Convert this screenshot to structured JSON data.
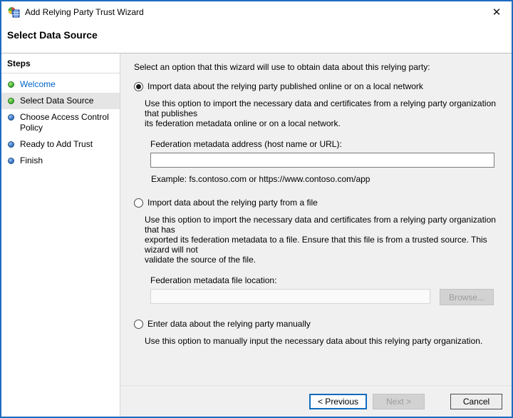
{
  "window": {
    "title": "Add Relying Party Trust Wizard",
    "close_glyph": "✕"
  },
  "page": {
    "heading": "Select Data Source"
  },
  "sidebar": {
    "title": "Steps",
    "items": [
      {
        "label": "Welcome",
        "state": "completed-link"
      },
      {
        "label": "Select Data Source",
        "state": "current"
      },
      {
        "label": "Choose Access Control Policy",
        "state": "pending"
      },
      {
        "label": "Ready to Add Trust",
        "state": "pending"
      },
      {
        "label": "Finish",
        "state": "pending"
      }
    ]
  },
  "content": {
    "intro": "Select an option that this wizard will use to obtain data about this relying party:",
    "options": [
      {
        "label": "Import data about the relying party published online or on a local network",
        "selected": true,
        "description": "Use this option to import the necessary data and certificates from a relying party organization that publishes\nits federation metadata online or on a local network.",
        "field_label": "Federation metadata address (host name or URL):",
        "field_value": "",
        "example": "Example: fs.contoso.com or https://www.contoso.com/app"
      },
      {
        "label": "Import data about the relying party from a file",
        "selected": false,
        "description": "Use this option to import the necessary data and certificates from a relying party organization that has\nexported its federation metadata to a file. Ensure that this file is from a trusted source.  This wizard will not\nvalidate the source of the file.",
        "field_label": "Federation metadata file location:",
        "field_value": "",
        "browse_label": "Browse..."
      },
      {
        "label": "Enter data about the relying party manually",
        "selected": false,
        "description": "Use this option to manually input the necessary data about this relying party organization."
      }
    ]
  },
  "footer": {
    "previous_label": "< Previous",
    "next_label": "Next >",
    "cancel_label": "Cancel"
  },
  "colors": {
    "window_border": "#1d6cc0",
    "content_bg": "#f0f0f0",
    "active_step_bg": "#e5e5e5",
    "link_blue": "#0066cc",
    "step_dot_green": "#45b332",
    "step_dot_blue": "#3a77c4",
    "focus_blue": "#0f6cbd"
  }
}
